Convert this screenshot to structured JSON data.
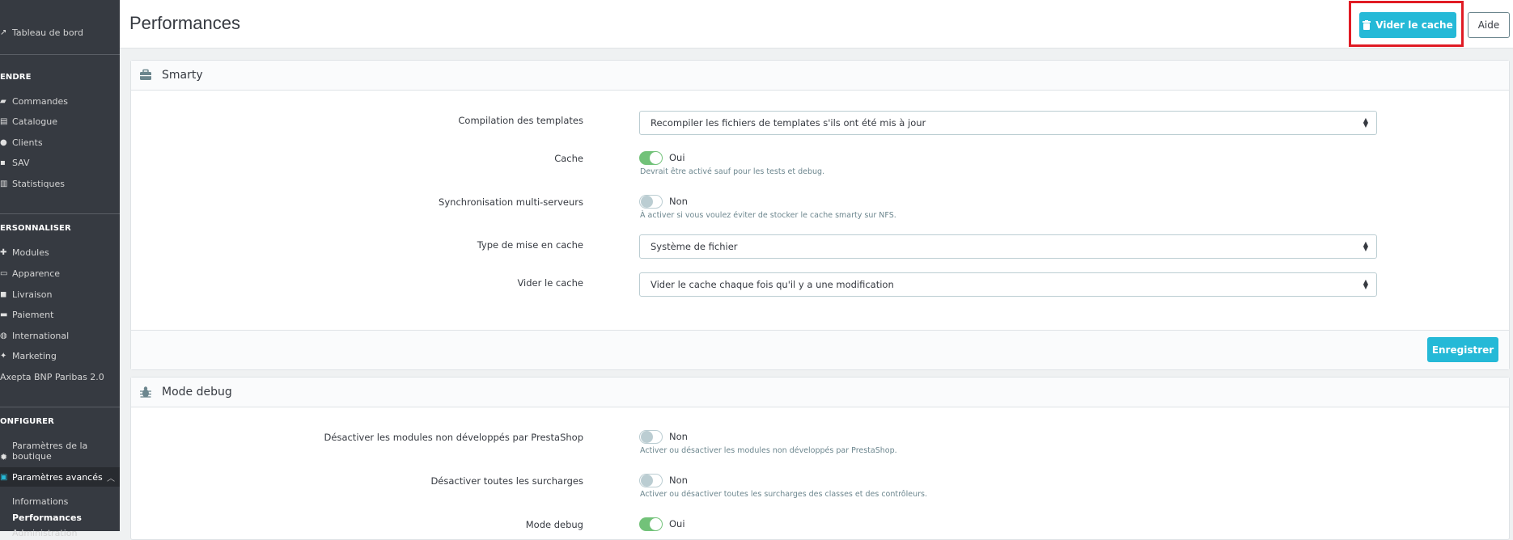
{
  "sidebar": {
    "dashboard": "Tableau de bord",
    "sections": [
      {
        "title": "ENDRE",
        "items": [
          "Commandes",
          "Catalogue",
          "Clients",
          "SAV",
          "Statistiques"
        ]
      },
      {
        "title": "ERSONNALISER",
        "items": [
          "Modules",
          "Apparence",
          "Livraison",
          "Paiement",
          "International",
          "Marketing"
        ]
      },
      {
        "title": "ONFIGURER"
      }
    ],
    "plugin_item": "Axepta BNP Paribas 2.0",
    "shop_params": "Paramètres de la boutique",
    "advanced_params": "Paramètres avancés",
    "sub_items": [
      "Informations",
      "Performances",
      "Administration"
    ]
  },
  "header": {
    "title": "Performances",
    "clear_cache_label": "Vider le cache",
    "help_label": "Aide"
  },
  "smarty": {
    "title": "Smarty",
    "compile_label": "Compilation des templates",
    "compile_value": "Recompiler les fichiers de templates s'ils ont été mis à jour",
    "cache_label": "Cache",
    "cache_state": "Oui",
    "cache_help": "Devrait être activé sauf pour les tests et debug.",
    "multi_label": "Synchronisation multi-serveurs",
    "multi_state": "Non",
    "multi_help": "À activer si vous voulez éviter de stocker le cache smarty sur NFS.",
    "type_label": "Type de mise en cache",
    "type_value": "Système de fichier",
    "clear_label": "Vider le cache",
    "clear_value": "Vider le cache chaque fois qu'il y a une modification",
    "save_label": "Enregistrer"
  },
  "debug": {
    "title": "Mode debug",
    "disable_modules_label": "Désactiver les modules non développés par PrestaShop",
    "disable_modules_state": "Non",
    "disable_modules_help": "Activer ou désactiver les modules non développés par PrestaShop.",
    "disable_overrides_label": "Désactiver toutes les surcharges",
    "disable_overrides_state": "Non",
    "disable_overrides_help": "Activer ou désactiver toutes les surcharges des classes et des contrôleurs.",
    "debug_label": "Mode debug",
    "debug_state": "Oui"
  },
  "colors": {
    "accent": "#25b9d7",
    "switch_on": "#72c279",
    "sidebar_bg": "#363a41",
    "highlight": "#e01b24"
  }
}
